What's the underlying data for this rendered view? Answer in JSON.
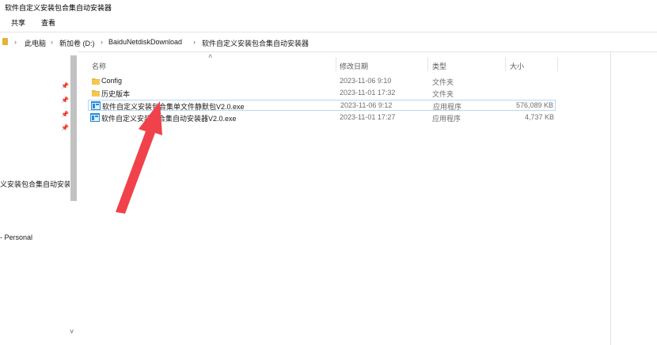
{
  "window": {
    "title": "软件自定义安装包合集自动安装器"
  },
  "ribbon": {
    "tabs": [
      "共享",
      "查看"
    ]
  },
  "address": {
    "crumbs": [
      "此电脑",
      "新加卷 (D:)",
      "BaiduNetdiskDownload",
      "软件自定义安装包合集自动安装器"
    ]
  },
  "nav": {
    "items": [
      "义安装包合集自动安装器",
      "- Personal"
    ],
    "pins": [
      "pin-icon",
      "pin-icon",
      "pin-icon",
      "pin-icon"
    ]
  },
  "columns": {
    "name": "名称",
    "date": "修改日期",
    "type": "类型",
    "size": "大小"
  },
  "files": [
    {
      "name": "Config",
      "date": "2023-11-06 9:10",
      "type": "文件夹",
      "size": "",
      "icon": "folder-icon"
    },
    {
      "name": "历史版本",
      "date": "2023-11-01 17:32",
      "type": "文件夹",
      "size": "",
      "icon": "folder-icon"
    },
    {
      "name": "软件自定义安装包合集单文件静默包V2.0.exe",
      "date": "2023-11-06 9:12",
      "type": "应用程序",
      "size": "576,089 KB",
      "icon": "exe-icon",
      "selected": true
    },
    {
      "name": "软件自定义安装包合集自动安装器V2.0.exe",
      "date": "2023-11-01 17:27",
      "type": "应用程序",
      "size": "4,737 KB",
      "icon": "exe-icon"
    }
  ],
  "colors": {
    "folder": "#e8b84a",
    "exe": "#2a8ad4",
    "arrow": "#f0424a",
    "selection_border": "#b9d7f5"
  }
}
